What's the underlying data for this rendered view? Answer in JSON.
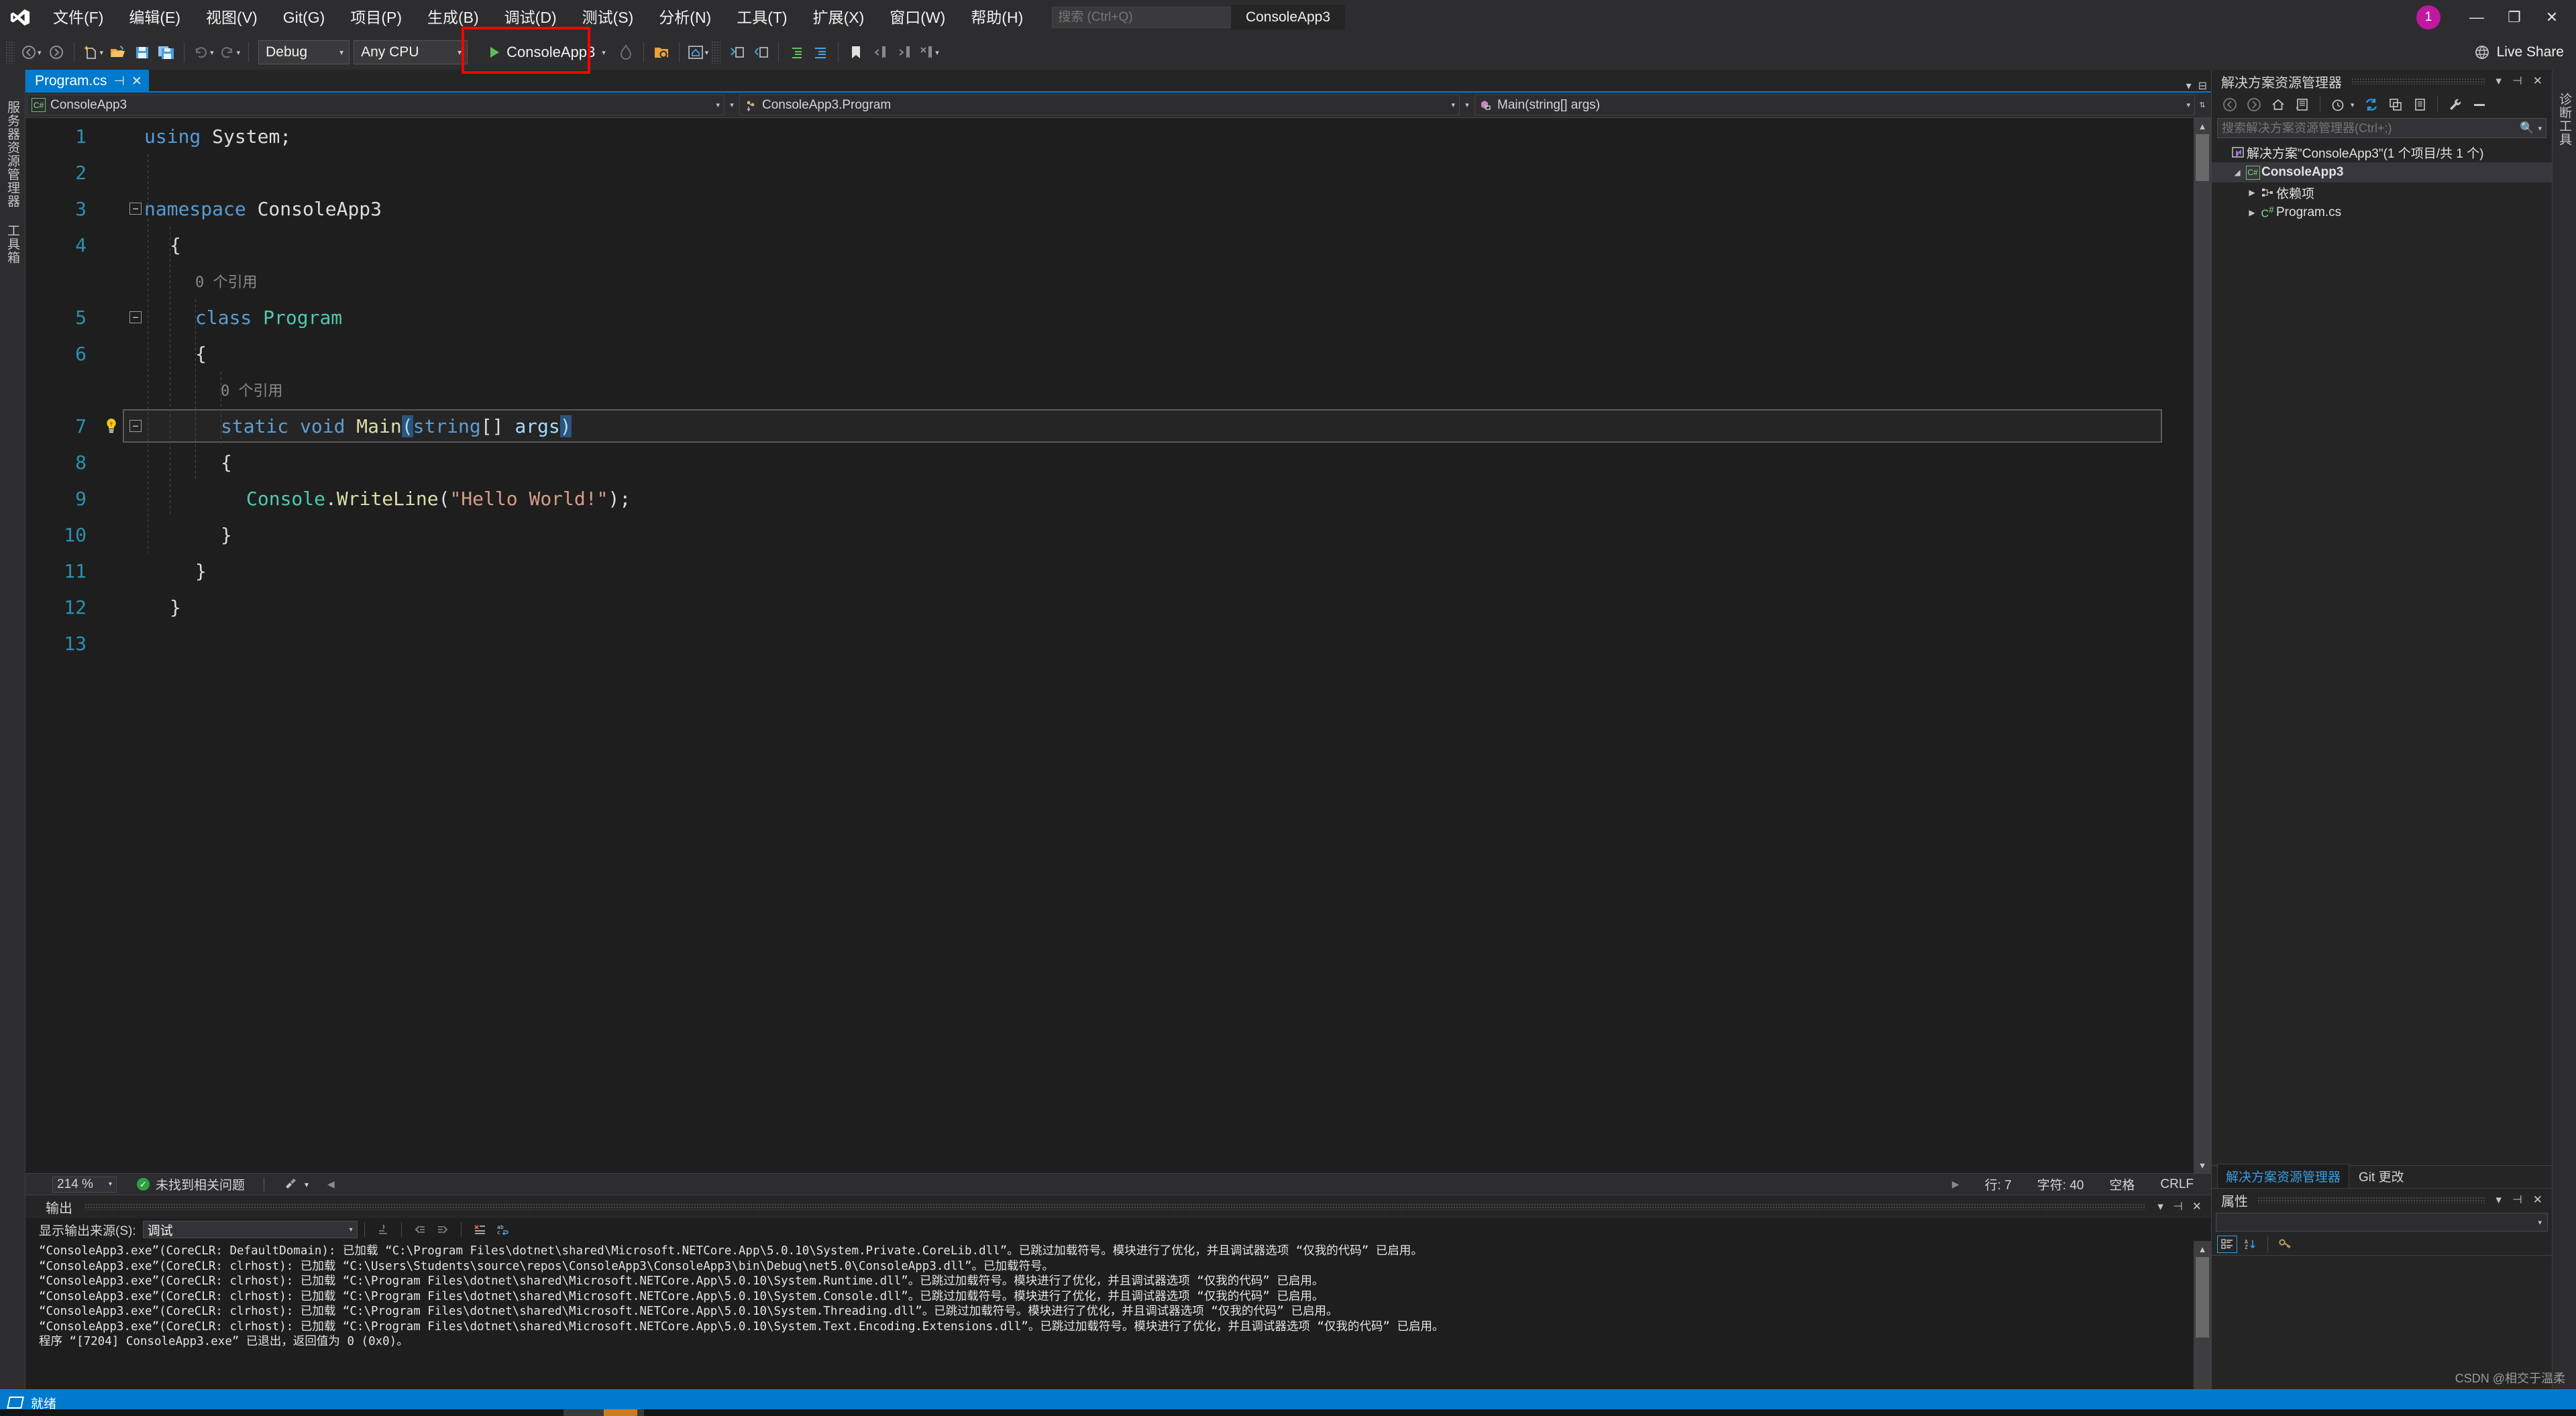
{
  "window": {
    "title": "ConsoleApp3",
    "avatar_initial": "1",
    "minimize": "—",
    "restore": "❐",
    "close": "✕"
  },
  "menu": {
    "items": [
      {
        "label": "文件(F)",
        "name": "file"
      },
      {
        "label": "编辑(E)",
        "name": "edit"
      },
      {
        "label": "视图(V)",
        "name": "view"
      },
      {
        "label": "Git(G)",
        "name": "git"
      },
      {
        "label": "项目(P)",
        "name": "project"
      },
      {
        "label": "生成(B)",
        "name": "build"
      },
      {
        "label": "调试(D)",
        "name": "debug"
      },
      {
        "label": "测试(S)",
        "name": "test"
      },
      {
        "label": "分析(N)",
        "name": "analyze"
      },
      {
        "label": "工具(T)",
        "name": "tools"
      },
      {
        "label": "扩展(X)",
        "name": "extensions"
      },
      {
        "label": "窗口(W)",
        "name": "window"
      },
      {
        "label": "帮助(H)",
        "name": "help"
      }
    ]
  },
  "search": {
    "placeholder": "搜索 (Ctrl+Q)",
    "value": ""
  },
  "toolbar": {
    "config": "Debug",
    "platform": "Any CPU",
    "run_target": "ConsoleApp3",
    "live_share": "Live Share",
    "highlight_color": "#fe0000"
  },
  "editor_tab": {
    "filename": "Program.cs",
    "pin": "⊣",
    "close": "✕"
  },
  "navbar": {
    "project": "ConsoleApp3",
    "type": "ConsoleApp3.Program",
    "member": "Main(string[] args)"
  },
  "code": {
    "lines": [
      {
        "n": "1",
        "indent": 0,
        "tokens": [
          {
            "t": "using ",
            "c": "kw"
          },
          {
            "t": "System;",
            "c": "plain"
          }
        ]
      },
      {
        "n": "2",
        "indent": 0,
        "tokens": []
      },
      {
        "n": "3",
        "indent": 0,
        "fold": "−",
        "tokens": [
          {
            "t": "namespace ",
            "c": "kw"
          },
          {
            "t": "ConsoleApp3",
            "c": "plain"
          }
        ]
      },
      {
        "n": "4",
        "indent": 1,
        "tokens": [
          {
            "t": "{",
            "c": "plain"
          }
        ]
      },
      {
        "n": "",
        "indent": 2,
        "hint": "0 个引用"
      },
      {
        "n": "5",
        "indent": 2,
        "fold": "−",
        "tokens": [
          {
            "t": "class ",
            "c": "kw"
          },
          {
            "t": "Program",
            "c": "type"
          }
        ]
      },
      {
        "n": "6",
        "indent": 2,
        "tokens": [
          {
            "t": "{",
            "c": "plain"
          }
        ]
      },
      {
        "n": "",
        "indent": 3,
        "hint": "0 个引用"
      },
      {
        "n": "7",
        "indent": 3,
        "fold": "−",
        "bulb": true,
        "current": true,
        "tokens": [
          {
            "t": "static void ",
            "c": "kw"
          },
          {
            "t": "Main",
            "c": "meth"
          },
          {
            "t": "(",
            "c": "brace"
          },
          {
            "t": "string",
            "c": "kw"
          },
          {
            "t": "[] ",
            "c": "plain"
          },
          {
            "t": "args",
            "c": "param"
          },
          {
            "t": ")",
            "c": "brace"
          }
        ]
      },
      {
        "n": "8",
        "indent": 3,
        "tokens": [
          {
            "t": "{",
            "c": "plain"
          }
        ]
      },
      {
        "n": "9",
        "indent": 4,
        "tokens": [
          {
            "t": "Console",
            "c": "type"
          },
          {
            "t": ".",
            "c": "plain"
          },
          {
            "t": "WriteLine",
            "c": "meth"
          },
          {
            "t": "(",
            "c": "plain"
          },
          {
            "t": "\"Hello World!\"",
            "c": "str"
          },
          {
            "t": ");",
            "c": "plain"
          }
        ]
      },
      {
        "n": "10",
        "indent": 3,
        "tokens": [
          {
            "t": "}",
            "c": "plain"
          }
        ]
      },
      {
        "n": "11",
        "indent": 2,
        "tokens": [
          {
            "t": "}",
            "c": "plain"
          }
        ]
      },
      {
        "n": "12",
        "indent": 1,
        "tokens": [
          {
            "t": "}",
            "c": "plain"
          }
        ]
      },
      {
        "n": "13",
        "indent": 0,
        "tokens": []
      }
    ]
  },
  "editor_status": {
    "zoom": "214 %",
    "issues": "未找到相关问题",
    "line_label": "行: 7",
    "char_label": "字符: 40",
    "spaces": "空格",
    "eol": "CRLF"
  },
  "output": {
    "title": "输出",
    "source_label": "显示输出来源(S):",
    "source_value": "调试",
    "lines": [
      "“ConsoleApp3.exe”(CoreCLR: DefaultDomain): 已加载 “C:\\Program Files\\dotnet\\shared\\Microsoft.NETCore.App\\5.0.10\\System.Private.CoreLib.dll”。已跳过加载符号。模块进行了优化，并且调试器选项 “仅我的代码” 已启用。",
      "“ConsoleApp3.exe”(CoreCLR: clrhost): 已加载 “C:\\Users\\Students\\source\\repos\\ConsoleApp3\\ConsoleApp3\\bin\\Debug\\net5.0\\ConsoleApp3.dll”。已加载符号。",
      "“ConsoleApp3.exe”(CoreCLR: clrhost): 已加载 “C:\\Program Files\\dotnet\\shared\\Microsoft.NETCore.App\\5.0.10\\System.Runtime.dll”。已跳过加载符号。模块进行了优化，并且调试器选项 “仅我的代码” 已启用。",
      "“ConsoleApp3.exe”(CoreCLR: clrhost): 已加载 “C:\\Program Files\\dotnet\\shared\\Microsoft.NETCore.App\\5.0.10\\System.Console.dll”。已跳过加载符号。模块进行了优化，并且调试器选项 “仅我的代码” 已启用。",
      "“ConsoleApp3.exe”(CoreCLR: clrhost): 已加载 “C:\\Program Files\\dotnet\\shared\\Microsoft.NETCore.App\\5.0.10\\System.Threading.dll”。已跳过加载符号。模块进行了优化，并且调试器选项 “仅我的代码” 已启用。",
      "“ConsoleApp3.exe”(CoreCLR: clrhost): 已加载 “C:\\Program Files\\dotnet\\shared\\Microsoft.NETCore.App\\5.0.10\\System.Text.Encoding.Extensions.dll”。已跳过加载符号。模块进行了优化，并且调试器选项 “仅我的代码” 已启用。",
      "程序 “[7204] ConsoleApp3.exe” 已退出，返回值为 0 (0x0)。"
    ]
  },
  "solution_explorer": {
    "title": "解决方案资源管理器",
    "search_placeholder": "搜索解决方案资源管理器(Ctrl+;)",
    "tree": [
      {
        "label": "解决方案\"ConsoleApp3\"(1 个项目/共 1 个)",
        "depth": 0,
        "icon": "solution-icon",
        "expander": ""
      },
      {
        "label": "ConsoleApp3",
        "depth": 1,
        "icon": "csharp-project-icon",
        "expander": "▲",
        "selected": true,
        "bold": true
      },
      {
        "label": "依赖项",
        "depth": 2,
        "icon": "dependencies-icon",
        "expander": "▶"
      },
      {
        "label": "Program.cs",
        "depth": 2,
        "icon": "csharp-file-icon",
        "expander": "▶"
      }
    ],
    "tabs": [
      {
        "label": "解决方案资源管理器",
        "active": true
      },
      {
        "label": "Git 更改",
        "active": false
      }
    ]
  },
  "properties": {
    "title": "属性",
    "selected_object": ""
  },
  "left_rail": {
    "tabs": [
      {
        "label": "服务器资源管理器"
      },
      {
        "label": "工具箱"
      }
    ]
  },
  "right_rail": {
    "tabs": [
      {
        "label": "诊断工具"
      }
    ]
  },
  "statusbar": {
    "status": "就绪"
  },
  "watermark": "CSDN @相交于温柔"
}
